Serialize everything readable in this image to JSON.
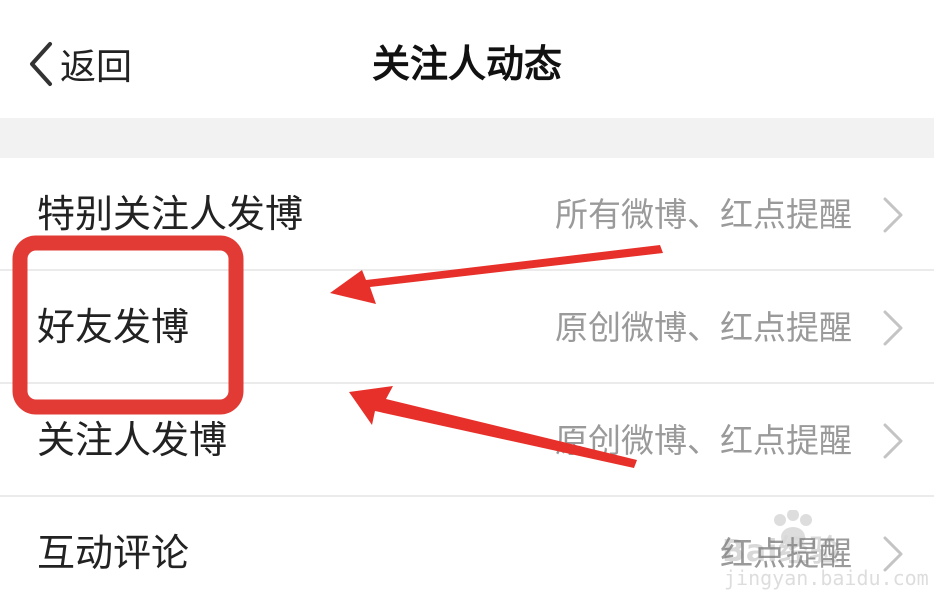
{
  "nav": {
    "back_label": "返回",
    "title": "关注人动态"
  },
  "rows": [
    {
      "label": "特别关注人发博",
      "value": "所有微博、红点提醒"
    },
    {
      "label": "好友发博",
      "value": "原创微博、红点提醒"
    },
    {
      "label": "关注人发博",
      "value": "原创微博、红点提醒"
    },
    {
      "label": "互动评论",
      "value": "红点提醒"
    }
  ],
  "annotation": {
    "color": "#e8302a",
    "highlight_color": "#e23b36",
    "highlighted_row": "好友发博"
  },
  "watermark": {
    "text": "Bai经验",
    "subtext": "jingyan.baidu.com"
  },
  "colors": {
    "background": "#ffffff",
    "separator_band": "#f2f2f2",
    "label": "#222222",
    "value": "#9a9a9a"
  }
}
